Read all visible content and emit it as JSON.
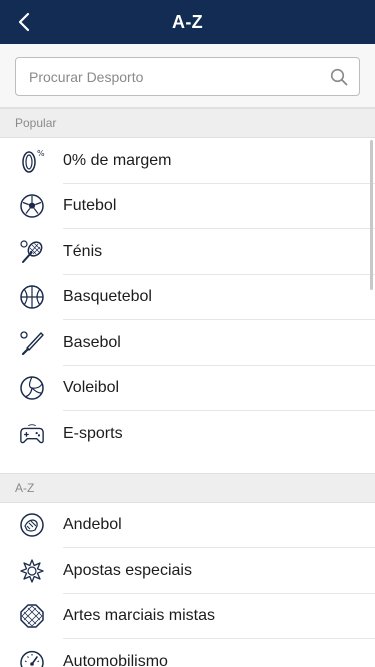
{
  "header": {
    "title": "A-Z"
  },
  "search": {
    "placeholder": "Procurar Desporto",
    "value": ""
  },
  "sections": {
    "popular": {
      "title": "Popular",
      "items": [
        {
          "label": "0% de margem",
          "icon": "zero-margin-icon"
        },
        {
          "label": "Futebol",
          "icon": "football-icon"
        },
        {
          "label": "Ténis",
          "icon": "tennis-icon"
        },
        {
          "label": "Basquetebol",
          "icon": "basketball-icon"
        },
        {
          "label": "Basebol",
          "icon": "baseball-icon"
        },
        {
          "label": "Voleibol",
          "icon": "volleyball-icon"
        },
        {
          "label": "E-sports",
          "icon": "gamepad-icon"
        }
      ]
    },
    "az": {
      "title": "A-Z",
      "items": [
        {
          "label": "Andebol",
          "icon": "handball-icon"
        },
        {
          "label": "Apostas especiais",
          "icon": "special-bets-icon"
        },
        {
          "label": "Artes marciais mistas",
          "icon": "mma-icon"
        },
        {
          "label": "Automobilismo",
          "icon": "motorsport-icon"
        }
      ]
    }
  },
  "colors": {
    "header_bg": "#132c53",
    "section_bg": "#eeeeee",
    "icon_stroke": "#1a2a4a"
  }
}
